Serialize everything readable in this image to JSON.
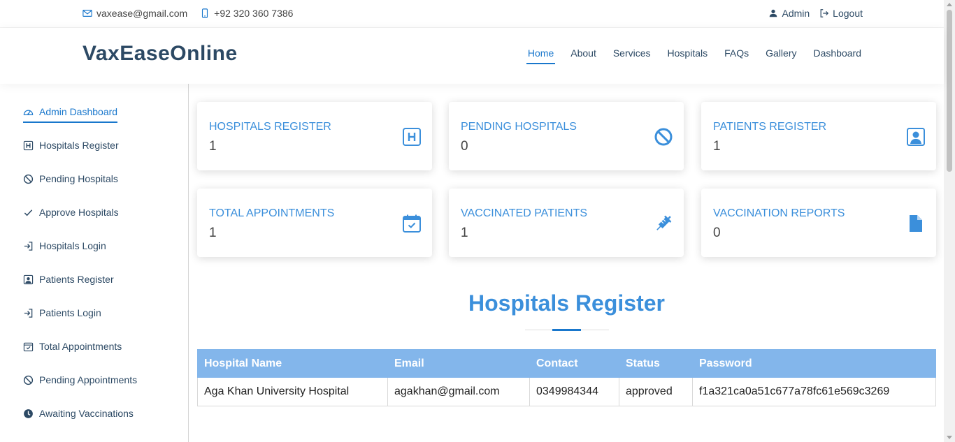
{
  "topbar": {
    "email": "vaxease@gmail.com",
    "phone": "+92 320 360 7386",
    "admin": "Admin",
    "logout": "Logout"
  },
  "header": {
    "logo": "VaxEaseOnline",
    "nav": [
      "Home",
      "About",
      "Services",
      "Hospitals",
      "FAQs",
      "Gallery",
      "Dashboard"
    ]
  },
  "sidebar": {
    "items": [
      {
        "label": "Admin Dashboard",
        "icon": "speedometer-icon"
      },
      {
        "label": "Hospitals Register",
        "icon": "hospital-h-icon"
      },
      {
        "label": "Pending Hospitals",
        "icon": "ban-icon"
      },
      {
        "label": "Approve Hospitals",
        "icon": "check-icon"
      },
      {
        "label": "Hospitals Login",
        "icon": "login-icon"
      },
      {
        "label": "Patients Register",
        "icon": "person-badge-icon"
      },
      {
        "label": "Patients Login",
        "icon": "login-icon"
      },
      {
        "label": "Total Appointments",
        "icon": "calendar-check-icon"
      },
      {
        "label": "Pending Appointments",
        "icon": "ban-icon"
      },
      {
        "label": "Awaiting Vaccinations",
        "icon": "clock-icon"
      }
    ]
  },
  "cards": [
    {
      "label": "Hospitals Register",
      "value": "1",
      "icon": "hospital-h-icon"
    },
    {
      "label": "Pending Hospitals",
      "value": "0",
      "icon": "ban-icon"
    },
    {
      "label": "Patients Register",
      "value": "1",
      "icon": "person-badge-icon"
    },
    {
      "label": "Total Appointments",
      "value": "1",
      "icon": "calendar-check-icon"
    },
    {
      "label": "Vaccinated Patients",
      "value": "1",
      "icon": "syringe-icon"
    },
    {
      "label": "Vaccination Reports",
      "value": "0",
      "icon": "file-icon"
    }
  ],
  "section": {
    "title": "Hospitals Register"
  },
  "table": {
    "headers": [
      "Hospital Name",
      "Email",
      "Contact",
      "Status",
      "Password"
    ],
    "rows": [
      [
        "Aga Khan University Hospital",
        "agakhan@gmail.com",
        "0349984344",
        "approved",
        "f1a321ca0a51c677a78fc61e569c3269"
      ]
    ]
  },
  "colors": {
    "accent": "#1977cc",
    "label_blue": "#3b8fdb",
    "table_header": "#83b6eb",
    "dark": "#2c4964"
  }
}
